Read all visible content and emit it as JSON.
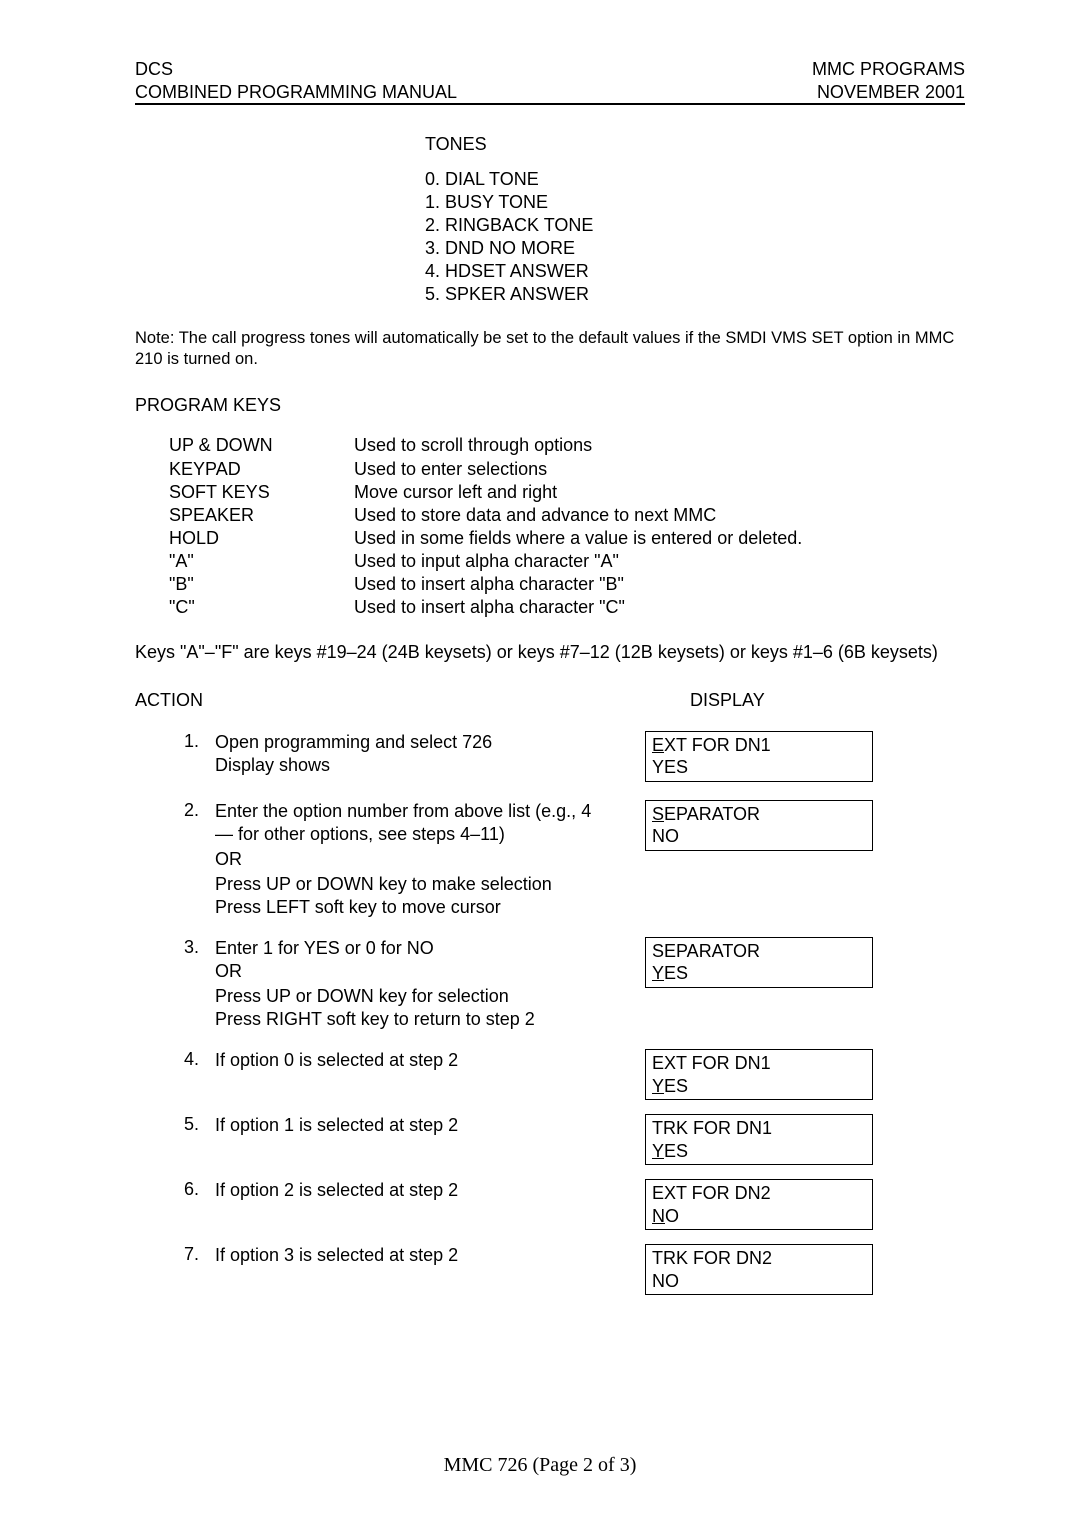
{
  "header": {
    "left_line1": "DCS",
    "left_line2": "COMBINED PROGRAMMING MANUAL",
    "right_line1": "MMC PROGRAMS",
    "right_line2": "NOVEMBER 2001"
  },
  "tones": {
    "title": "TONES",
    "items": [
      "0. DIAL TONE",
      "1. BUSY TONE",
      "2. RINGBACK TONE",
      "3. DND NO MORE",
      "4. HDSET ANSWER",
      "5. SPKER ANSWER"
    ]
  },
  "note": "Note: The call progress tones will automatically be set to the default values if the SMDI VMS SET option in MMC 210 is turned on.",
  "program_keys": {
    "title": "PROGRAM KEYS",
    "rows": [
      {
        "k": "UP & DOWN",
        "d": "Used to scroll through options"
      },
      {
        "k": "KEYPAD",
        "d": "Used to enter selections"
      },
      {
        "k": "SOFT KEYS",
        "d": "Move cursor left and right"
      },
      {
        "k": "SPEAKER",
        "d": "Used to store data and advance to next MMC"
      },
      {
        "k": "HOLD",
        "d": "Used in some fields where a value is entered or deleted."
      },
      {
        "k": "\"A\"",
        "d": "Used to input alpha character \"A\""
      },
      {
        "k": "\"B\"",
        "d": "Used to insert alpha character \"B\""
      },
      {
        "k": "\"C\"",
        "d": "Used to insert alpha character \"C\""
      }
    ],
    "footnote": "Keys \"A\"–\"F\" are keys #19–24 (24B keysets) or keys #7–12 (12B keysets) or keys #1–6 (6B keysets)"
  },
  "action_display": {
    "action_label": "ACTION",
    "display_label": "DISPLAY"
  },
  "steps": [
    {
      "num": "1.",
      "lines": [
        "Open programming and select 726",
        "Display shows"
      ],
      "display": {
        "l1": "EXT FOR DN1",
        "l2": "YES",
        "u1": true,
        "u2": false
      }
    },
    {
      "num": "2.",
      "lines": [
        "Enter the option number from above list (e.g., 4 — for other options, see steps 4–11)",
        "OR",
        "Press UP or DOWN key to make selection",
        "Press LEFT soft key to move cursor"
      ],
      "display": {
        "l1": "SEPARATOR",
        "l2": "NO",
        "u1": true,
        "u2": false
      }
    },
    {
      "num": "3.",
      "lines": [
        "Enter 1 for YES or 0 for NO",
        "OR",
        "Press UP or DOWN key for selection",
        "Press RIGHT soft key to return to step 2"
      ],
      "display": {
        "l1": "SEPARATOR",
        "l2": "YES",
        "u1": false,
        "u2": true
      }
    },
    {
      "num": "4.",
      "lines": [
        "If option 0 is selected at step 2"
      ],
      "display": {
        "l1": "EXT FOR DN1",
        "l2": "YES",
        "u1": false,
        "u2": true
      }
    },
    {
      "num": "5.",
      "lines": [
        "If option 1 is selected at step 2"
      ],
      "display": {
        "l1": "TRK FOR DN1",
        "l2": "YES",
        "u1": false,
        "u2": true
      }
    },
    {
      "num": "6.",
      "lines": [
        "If option 2 is selected at step 2"
      ],
      "display": {
        "l1": "EXT FOR DN2",
        "l2": "NO",
        "u1": false,
        "u2": true
      }
    },
    {
      "num": "7.",
      "lines": [
        "If option 3 is selected at step 2"
      ],
      "display": {
        "l1": "TRK FOR DN2",
        "l2": "NO",
        "u1": false,
        "u2": false
      }
    }
  ],
  "footer": "MMC 726 (Page 2 of 3)"
}
